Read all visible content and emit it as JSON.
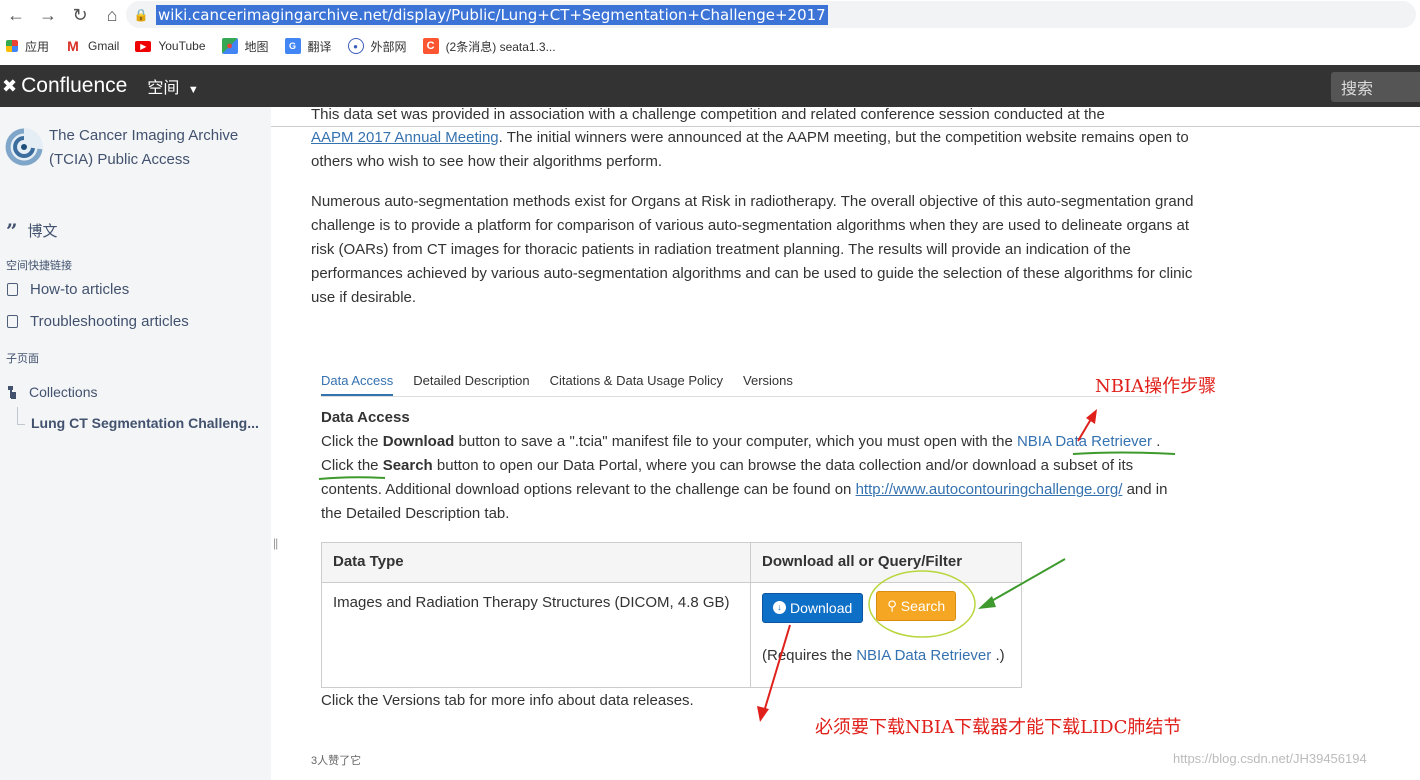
{
  "browser": {
    "url": "wiki.cancerimagingarchive.net/display/Public/Lung+CT+Segmentation+Challenge+2017",
    "bookmarks": [
      {
        "label": "应用",
        "icon": "apps-grid-icon"
      },
      {
        "label": "Gmail",
        "icon": "gmail-icon"
      },
      {
        "label": "YouTube",
        "icon": "youtube-icon"
      },
      {
        "label": "地图",
        "icon": "maps-icon"
      },
      {
        "label": "翻译",
        "icon": "translate-icon"
      },
      {
        "label": "外部网",
        "icon": "globe-icon"
      },
      {
        "label": "(2条消息) seata1.3...",
        "icon": "csdn-icon"
      }
    ]
  },
  "header": {
    "logo": "Confluence",
    "spaces": "空间",
    "search_placeholder": "搜索"
  },
  "sidebar": {
    "space_title": "The Cancer Imaging Archive (TCIA) Public Access",
    "blog": "博文",
    "shortcuts_heading": "空间快捷链接",
    "shortcuts": [
      "How-to articles",
      "Troubleshooting articles"
    ],
    "children_heading": "子页面",
    "collections": "Collections",
    "child": "Lung CT Segmentation Challeng..."
  },
  "content": {
    "cut_line": "This data set was provided in association with a challenge competition and related conference session conducted at the",
    "para1_link": "AAPM 2017 Annual Meeting",
    "para1_rest": ". The initial winners were announced at the AAPM meeting, but the competition website remains open to others who wish to see how their algorithms perform.",
    "para2": "Numerous auto-segmentation methods exist for Organs at Risk in radiotherapy. The overall objective of this auto-segmentation grand challenge is to provide a platform for comparison of various auto-segmentation algorithms when they are used to delineate organs at risk (OARs) from CT images for thoracic patients in radiation treatment planning. The results will provide an indication of the performances achieved by various auto-segmentation algorithms and can be used to guide the selection of these algorithms for clinic use if desirable.",
    "tabs": [
      "Data Access",
      "Detailed Description",
      "Citations & Data Usage Policy",
      "Versions"
    ],
    "data_access_title": "Data Access",
    "da_1": "Click the ",
    "da_download": "Download",
    "da_2": " button to save a \".tcia\" manifest file to your computer, which you must open with the ",
    "da_nbia_link": "NBIA Data Retriever",
    "da_3": " . Click the ",
    "da_search": "Search",
    "da_4": " button to open our Data Portal, where you can browse the data collection and/or download a subset of its contents. Additional download options relevant to the challenge can be found on ",
    "da_url": "http://www.autocontouringchallenge.org/",
    "da_5": " and in the Detailed Description tab.",
    "table": {
      "headers": [
        "Data Type",
        "Download all or Query/Filter"
      ],
      "row_type": "Images and Radiation Therapy Structures (DICOM, 4.8 GB)",
      "download_btn": "Download",
      "search_btn": "Search",
      "req_pre": "(Requires the ",
      "req_link": "NBIA Data Retriever",
      "req_post": " .)"
    },
    "versions_note": "Click the Versions tab for more info about data releases.",
    "likes": "3人赞了它"
  },
  "annotations": {
    "nbia_steps": "NBIA操作步骤",
    "must_download": "必须要下载NBIA下载器才能下载LIDC肺结节",
    "watermark": "https://blog.csdn.net/JH39456194"
  },
  "colors": {
    "accent": "#3572b0",
    "header_bg": "#333333",
    "sidebar_bg": "#f4f5f7",
    "download_btn": "#0e6fc7",
    "search_btn": "#f5a623",
    "annotation_red": "#e0201a",
    "annotation_green": "#4a9a2a"
  }
}
